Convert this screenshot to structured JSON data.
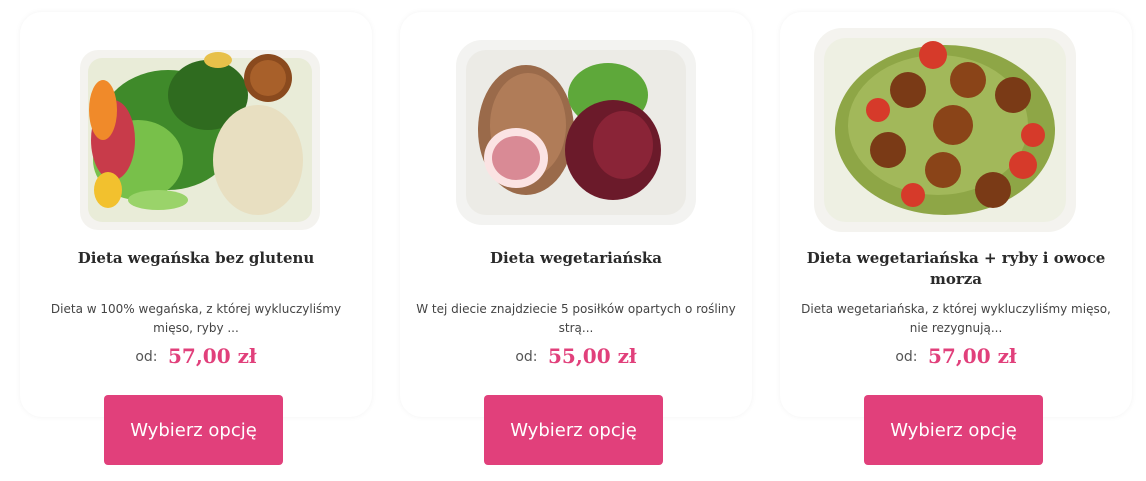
{
  "products": [
    {
      "title": "Dieta wegańska bez glutenu",
      "description": "Dieta w 100% wegańska, z której wykluczyliśmy mięso, ryby ...",
      "price_prefix": "od:",
      "price": "57,00 zł",
      "button": "Wybierz opcję"
    },
    {
      "title": "Dieta wegetariańska",
      "description": "W tej diecie znajdziecie 5 posiłków opartych o rośliny strą...",
      "price_prefix": "od:",
      "price": "55,00 zł",
      "button": "Wybierz opcję"
    },
    {
      "title": "Dieta wegetariańska + ryby i owoce morza",
      "description": "Dieta wegetariańska, z której wykluczyliśmy mięso, nie rezygnują...",
      "price_prefix": "od:",
      "price": "57,00 zł",
      "button": "Wybierz opcję"
    }
  ],
  "colors": {
    "accent": "#e1407b",
    "title": "#2a2a2a",
    "text": "#444444"
  }
}
